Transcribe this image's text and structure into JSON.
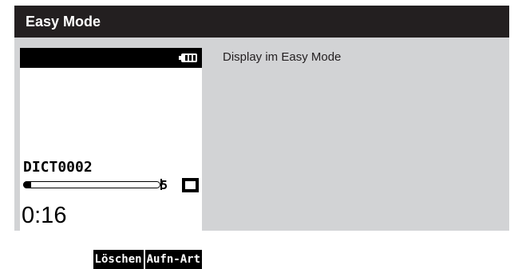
{
  "section": {
    "title": "Easy Mode"
  },
  "device": {
    "battery_icon": "battery-full-icon",
    "filename": "DICT0002",
    "progress": 0.06,
    "file_index": "5",
    "status_icon": "stop-icon",
    "elapsed_time": "0:16",
    "softkeys": [
      "Löschen",
      "Aufn-Art"
    ]
  },
  "description": "Display im Easy Mode",
  "colors": {
    "header_bg": "#231f20",
    "panel_bg": "#d2d3d5",
    "display_bg": "#ffffff",
    "display_fg": "#000000"
  }
}
